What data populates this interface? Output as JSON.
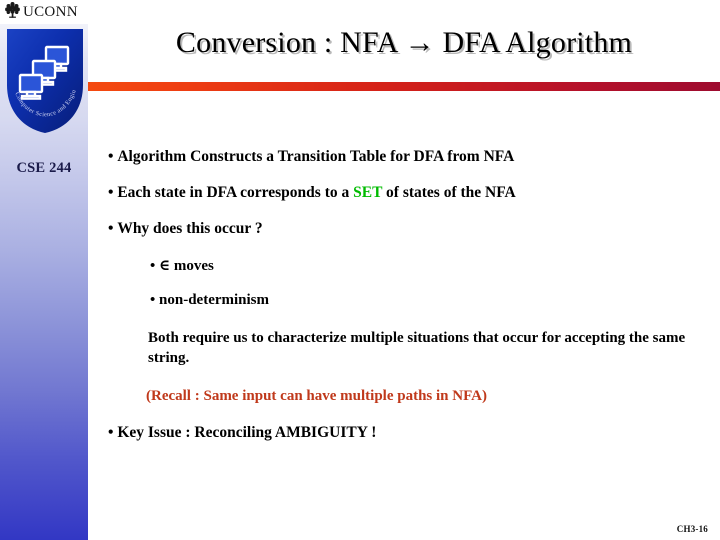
{
  "slide": {
    "title": "Conversion :  NFA → DFA Algorithm",
    "slide_number": "CH3-16",
    "accent_bar_left_color": "#f44a10",
    "accent_bar_right_color": "#9e0b2f"
  },
  "sidebar": {
    "wordmark": "UCONN",
    "tree_icon_name": "uconn-oak-tree-icon",
    "shield_icon_name": "cse-shield-logo",
    "shield_arc_text": "Computer Science and Engineering",
    "course_label": "CSE 244",
    "shield_color": "#0a2ea8",
    "course_label_color": "#1b1b4a"
  },
  "body": {
    "bullets": [
      {
        "level": 1,
        "text": "Algorithm Constructs a Transition Table for DFA from NFA"
      },
      {
        "level": 1,
        "text_before": "Each state in DFA corresponds to a ",
        "highlight": "SET",
        "highlight_color": "#00bb00",
        "text_after": " of states of the NFA"
      },
      {
        "level": 1,
        "text": "Why does this occur ?"
      },
      {
        "level": 2,
        "text": "∈ moves"
      },
      {
        "level": 2,
        "text": "non-determinism"
      }
    ],
    "paragraph": "Both require us to characterize multiple situations that occur for accepting the same string.",
    "recall_note": "(Recall : Same input can have multiple paths in NFA)",
    "recall_color": "#c0391b",
    "key_issue": "Key Issue :  Reconciling AMBIGUITY !"
  }
}
